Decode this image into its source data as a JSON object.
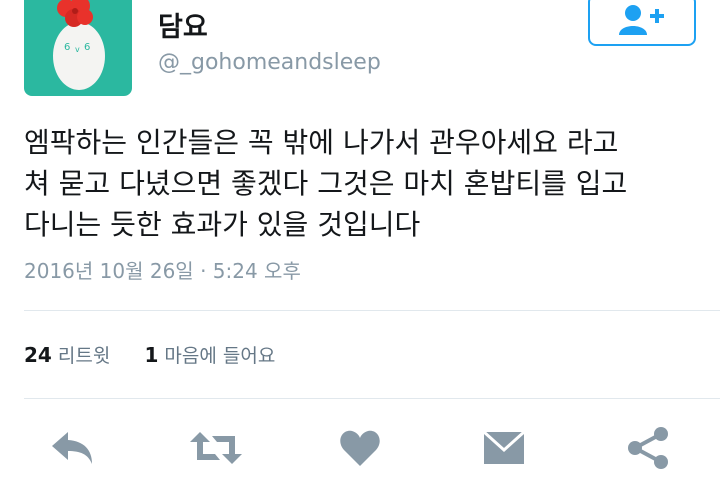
{
  "user": {
    "display_name": "담요",
    "handle": "@_gohomeandsleep"
  },
  "follow_button": {
    "icon": "add-user-icon"
  },
  "tweet": {
    "lines": [
      "엠팍하는 인간들은 꼭 밖에 나가서 관우아세요 라고",
      "쳐 묻고 다녔으면 좋겠다 그것은 마치 혼밥티를 입고",
      "다니는 듯한 효과가 있을 것입니다"
    ],
    "timestamp": "2016년 10월 26일 · 5:24 오후"
  },
  "stats": {
    "retweets_count": "24",
    "retweets_label": "리트윗",
    "likes_count": "1",
    "likes_label": "마음에 들어요"
  },
  "actions": [
    "reply-icon",
    "retweet-icon",
    "like-icon",
    "message-icon",
    "share-icon"
  ],
  "colors": {
    "accent": "#1da1f2",
    "icon_gray": "#8899a6",
    "avatar_bg": "#2bb8a0"
  }
}
